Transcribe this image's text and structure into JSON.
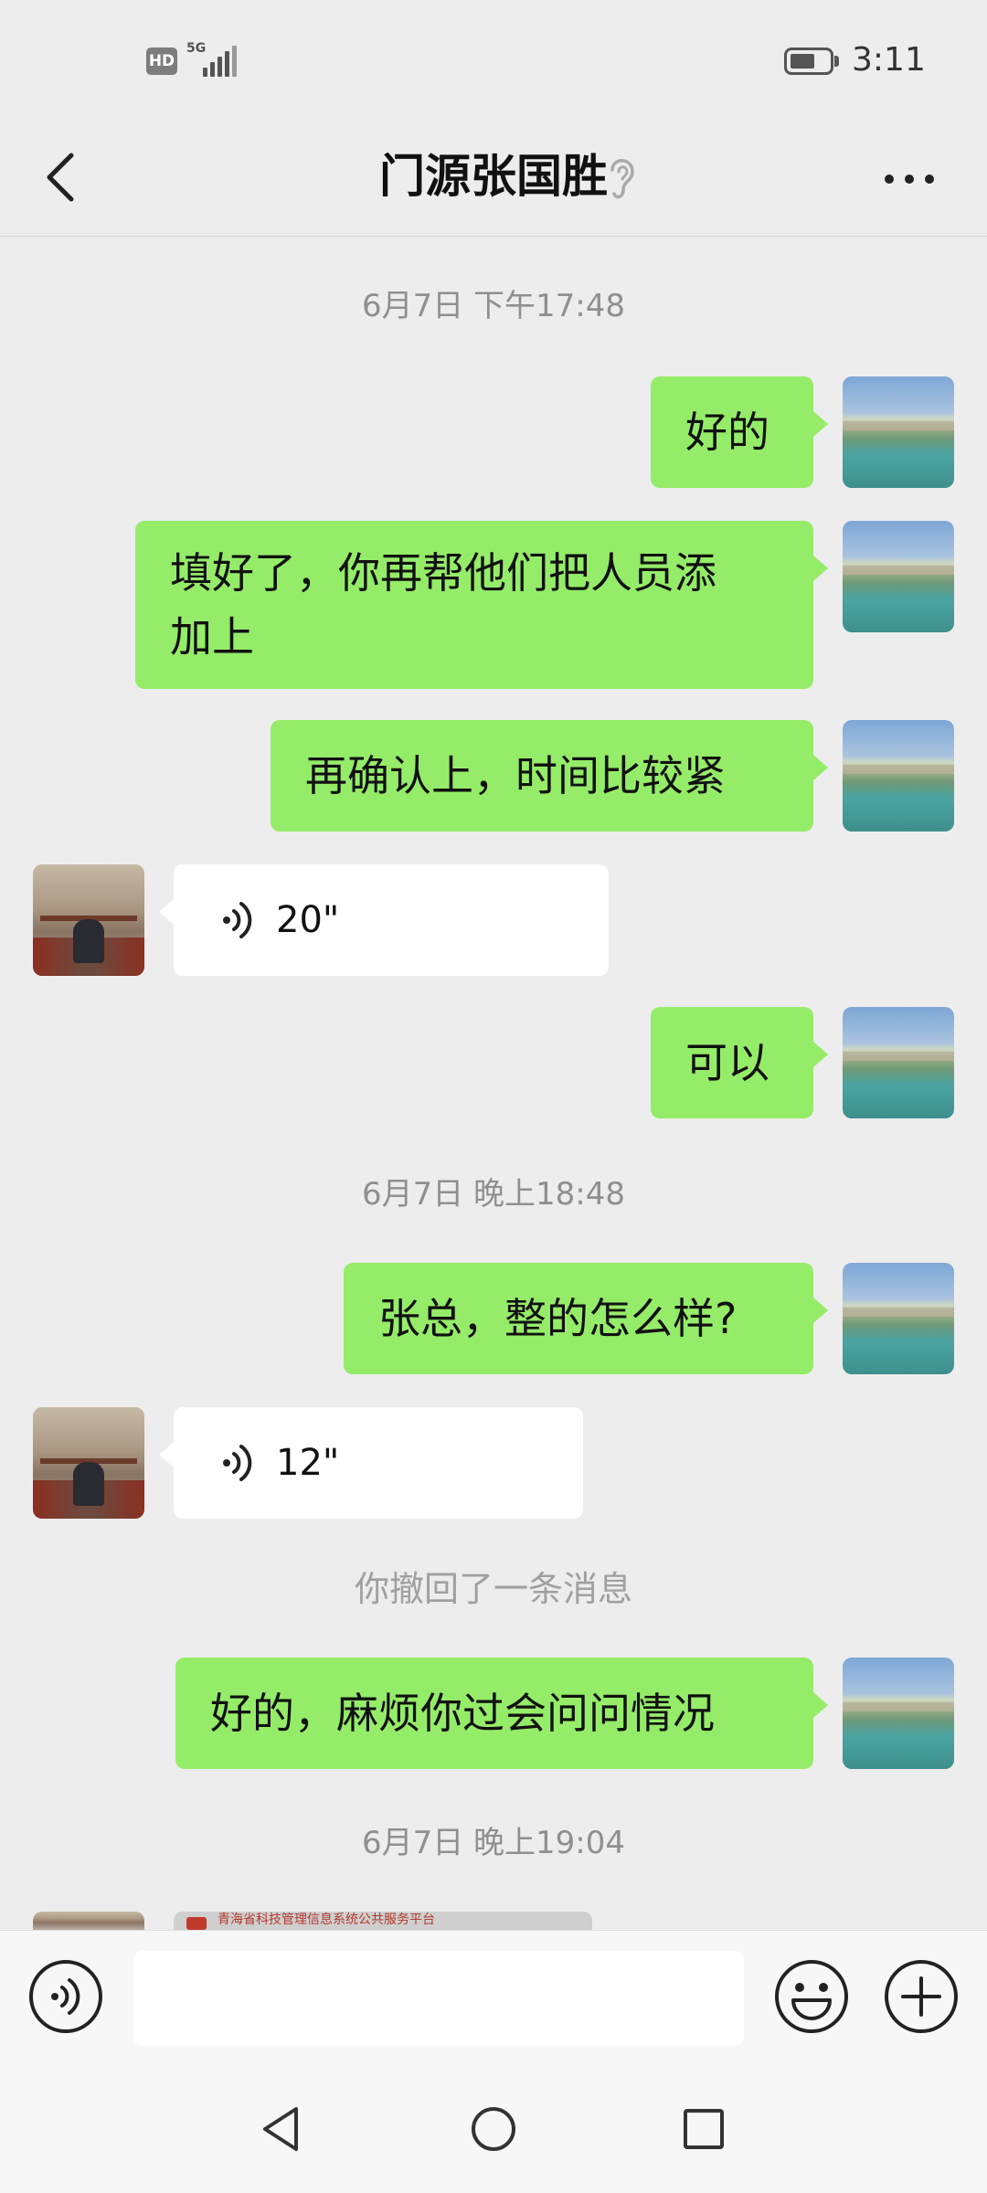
{
  "status_bar": {
    "hd": "HD",
    "network": "5G",
    "time": "3:11"
  },
  "header": {
    "title": "门源张国胜",
    "back_icon": "chevron-left-icon",
    "ear_icon": "ear-icon",
    "more_icon": "more-icon"
  },
  "timestamps": [
    "6月7日 下午17:48",
    "6月7日 晚上18:48",
    "6月7日 晚上19:04"
  ],
  "messages": [
    {
      "from": "me",
      "type": "text",
      "text": "好的"
    },
    {
      "from": "me",
      "type": "text",
      "text": "填好了，你再帮他们把人员添",
      "text_line2": "加上"
    },
    {
      "from": "me",
      "type": "text",
      "text": "再确认上，时间比较紧"
    },
    {
      "from": "peer",
      "type": "voice",
      "duration": "20\""
    },
    {
      "from": "me",
      "type": "text",
      "text": "可以"
    },
    {
      "from": "me",
      "type": "text",
      "text": "张总，整的怎么样?"
    },
    {
      "from": "peer",
      "type": "voice",
      "duration": "12\""
    },
    {
      "from": "me",
      "type": "text",
      "text": "好的，麻烦你过会问问情况"
    }
  ],
  "recalled_notice": "你撤回了一条消息",
  "image_preview_caption": "青海省科技管理信息系统公共服务平台",
  "composer": {
    "input_value": "",
    "voice_icon": "voice-icon",
    "emoji_icon": "emoji-icon",
    "plus_icon": "plus-icon"
  },
  "system_nav": {
    "back": "triangle-back-icon",
    "home": "circle-home-icon",
    "recents": "square-recents-icon"
  },
  "colors": {
    "sent_bubble": "#95ec69",
    "received_bubble": "#ffffff",
    "background": "#ededed"
  }
}
